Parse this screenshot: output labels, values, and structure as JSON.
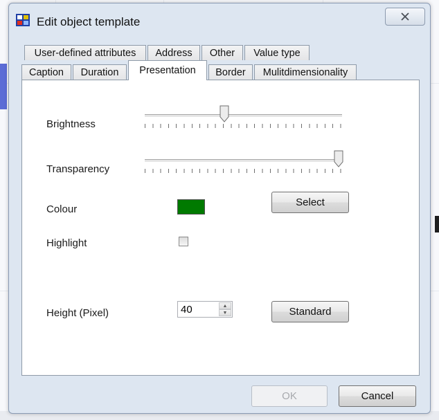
{
  "window": {
    "title": "Edit object template",
    "close_glyph": "✕"
  },
  "tabs": {
    "row_back": [
      {
        "label": "User-defined attributes"
      },
      {
        "label": "Address"
      },
      {
        "label": "Other"
      },
      {
        "label": "Value type"
      }
    ],
    "row_front": [
      {
        "label": "Caption"
      },
      {
        "label": "Duration"
      },
      {
        "label": "Presentation",
        "active": true
      },
      {
        "label": "Border"
      },
      {
        "label": "Mulitdimensionality"
      }
    ]
  },
  "presentation": {
    "brightness": {
      "label": "Brightness",
      "value_fraction": 0.4
    },
    "transparency": {
      "label": "Transparency",
      "value_fraction": 1.0
    },
    "colour": {
      "label": "Colour",
      "swatch_color": "#007a00"
    },
    "select_button": "Select",
    "highlight": {
      "label": "Highlight",
      "checked": false
    },
    "height": {
      "label": "Height (Pixel)",
      "value": "40"
    },
    "standard_button": "Standard"
  },
  "footer": {
    "ok_label": "OK",
    "cancel_label": "Cancel"
  },
  "colors": {
    "dialog_bg": "#dde6f1",
    "panel_bg": "#ffffff",
    "swatch": "#007a00"
  }
}
